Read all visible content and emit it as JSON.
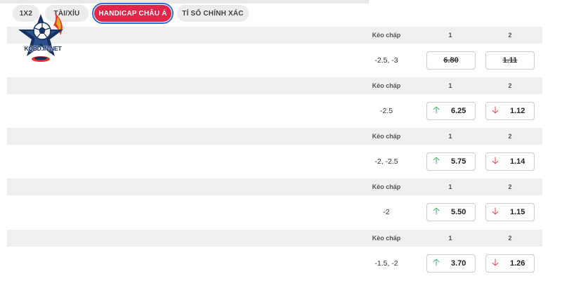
{
  "tabs": [
    {
      "label": "1X2",
      "active": false
    },
    {
      "label": "TÀI/XỈU",
      "active": false
    },
    {
      "label": "HANDICAP CHÂU Á",
      "active": true
    },
    {
      "label": "TỈ SỐ CHÍNH XÁC",
      "active": false
    }
  ],
  "logo": {
    "text": "KQBD.IN.NET"
  },
  "colors": {
    "accent": "#e2264a",
    "up": "#2fae4f",
    "down": "#e0263a",
    "header_bg": "#efefef"
  },
  "markets": [
    {
      "label": "Kèo chấp",
      "col1": "1",
      "col2": "2",
      "handicap": "-2.5, -3",
      "odd1": {
        "value": "6.80",
        "trend": "none",
        "suspended": true
      },
      "odd2": {
        "value": "1.11",
        "trend": "none",
        "suspended": true
      }
    },
    {
      "label": "Kèo chấp",
      "col1": "1",
      "col2": "2",
      "handicap": "-2.5",
      "odd1": {
        "value": "6.25",
        "trend": "up",
        "suspended": false
      },
      "odd2": {
        "value": "1.12",
        "trend": "down",
        "suspended": false
      }
    },
    {
      "label": "Kèo chấp",
      "col1": "1",
      "col2": "2",
      "handicap": "-2, -2.5",
      "odd1": {
        "value": "5.75",
        "trend": "up",
        "suspended": false
      },
      "odd2": {
        "value": "1.14",
        "trend": "down",
        "suspended": false
      }
    },
    {
      "label": "Kèo chấp",
      "col1": "1",
      "col2": "2",
      "handicap": "-2",
      "odd1": {
        "value": "5.50",
        "trend": "up",
        "suspended": false
      },
      "odd2": {
        "value": "1.15",
        "trend": "down",
        "suspended": false
      }
    },
    {
      "label": "Kèo chấp",
      "col1": "1",
      "col2": "2",
      "handicap": "-1.5, -2",
      "odd1": {
        "value": "3.70",
        "trend": "up",
        "suspended": false
      },
      "odd2": {
        "value": "1.26",
        "trend": "down",
        "suspended": false
      }
    }
  ]
}
